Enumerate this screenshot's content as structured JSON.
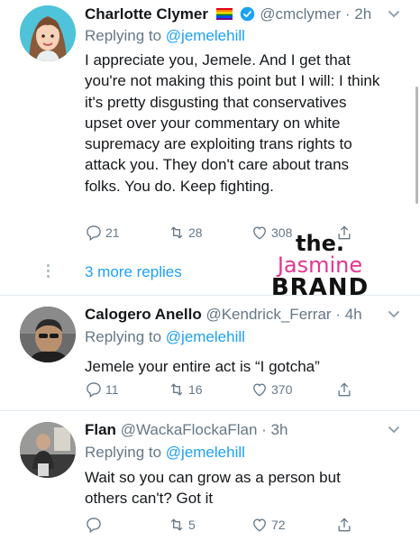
{
  "tweets": [
    {
      "name": "Charlotte Clymer",
      "handle": "@cmclymer",
      "time": "· 2h",
      "replying_prefix": "Replying to ",
      "replying_mention": "@jemelehill",
      "text": "I appreciate you, Jemele. And I get that you're not making this point but I will: I think it's pretty disgusting that conservatives upset over your commentary on white supremacy are exploiting trans rights to attack you. They don't care about trans folks. You do. Keep fighting.",
      "reply_count": "21",
      "retweet_count": "28",
      "like_count": "308",
      "avatar_icon": "memoji-avatar"
    },
    {
      "name": "Calogero Anello",
      "handle": "@Kendrick_Ferrar",
      "time": "· 4h",
      "replying_prefix": "Replying to ",
      "replying_mention": "@jemelehill",
      "text": "Jemele your entire act is “I gotcha”",
      "reply_count": "11",
      "retweet_count": "16",
      "like_count": "370",
      "avatar_icon": "photo-avatar"
    },
    {
      "name": "Flan",
      "handle": "@WackaFlockaFlan",
      "time": "· 3h",
      "replying_prefix": "Replying to ",
      "replying_mention": "@jemelehill",
      "text": "Wait so you can grow as a person but others can't? Got it",
      "reply_count": "",
      "retweet_count": "5",
      "like_count": "72",
      "avatar_icon": "photo-avatar"
    }
  ],
  "more_replies": "3 more replies",
  "watermark": {
    "the": "the.",
    "jasmine": "Jasmine",
    "brand": "BRAND"
  },
  "colors": {
    "accent": "#1da1f2",
    "muted": "#657786",
    "verified": "#1da1f2",
    "brand_pink": "#e4368f"
  }
}
